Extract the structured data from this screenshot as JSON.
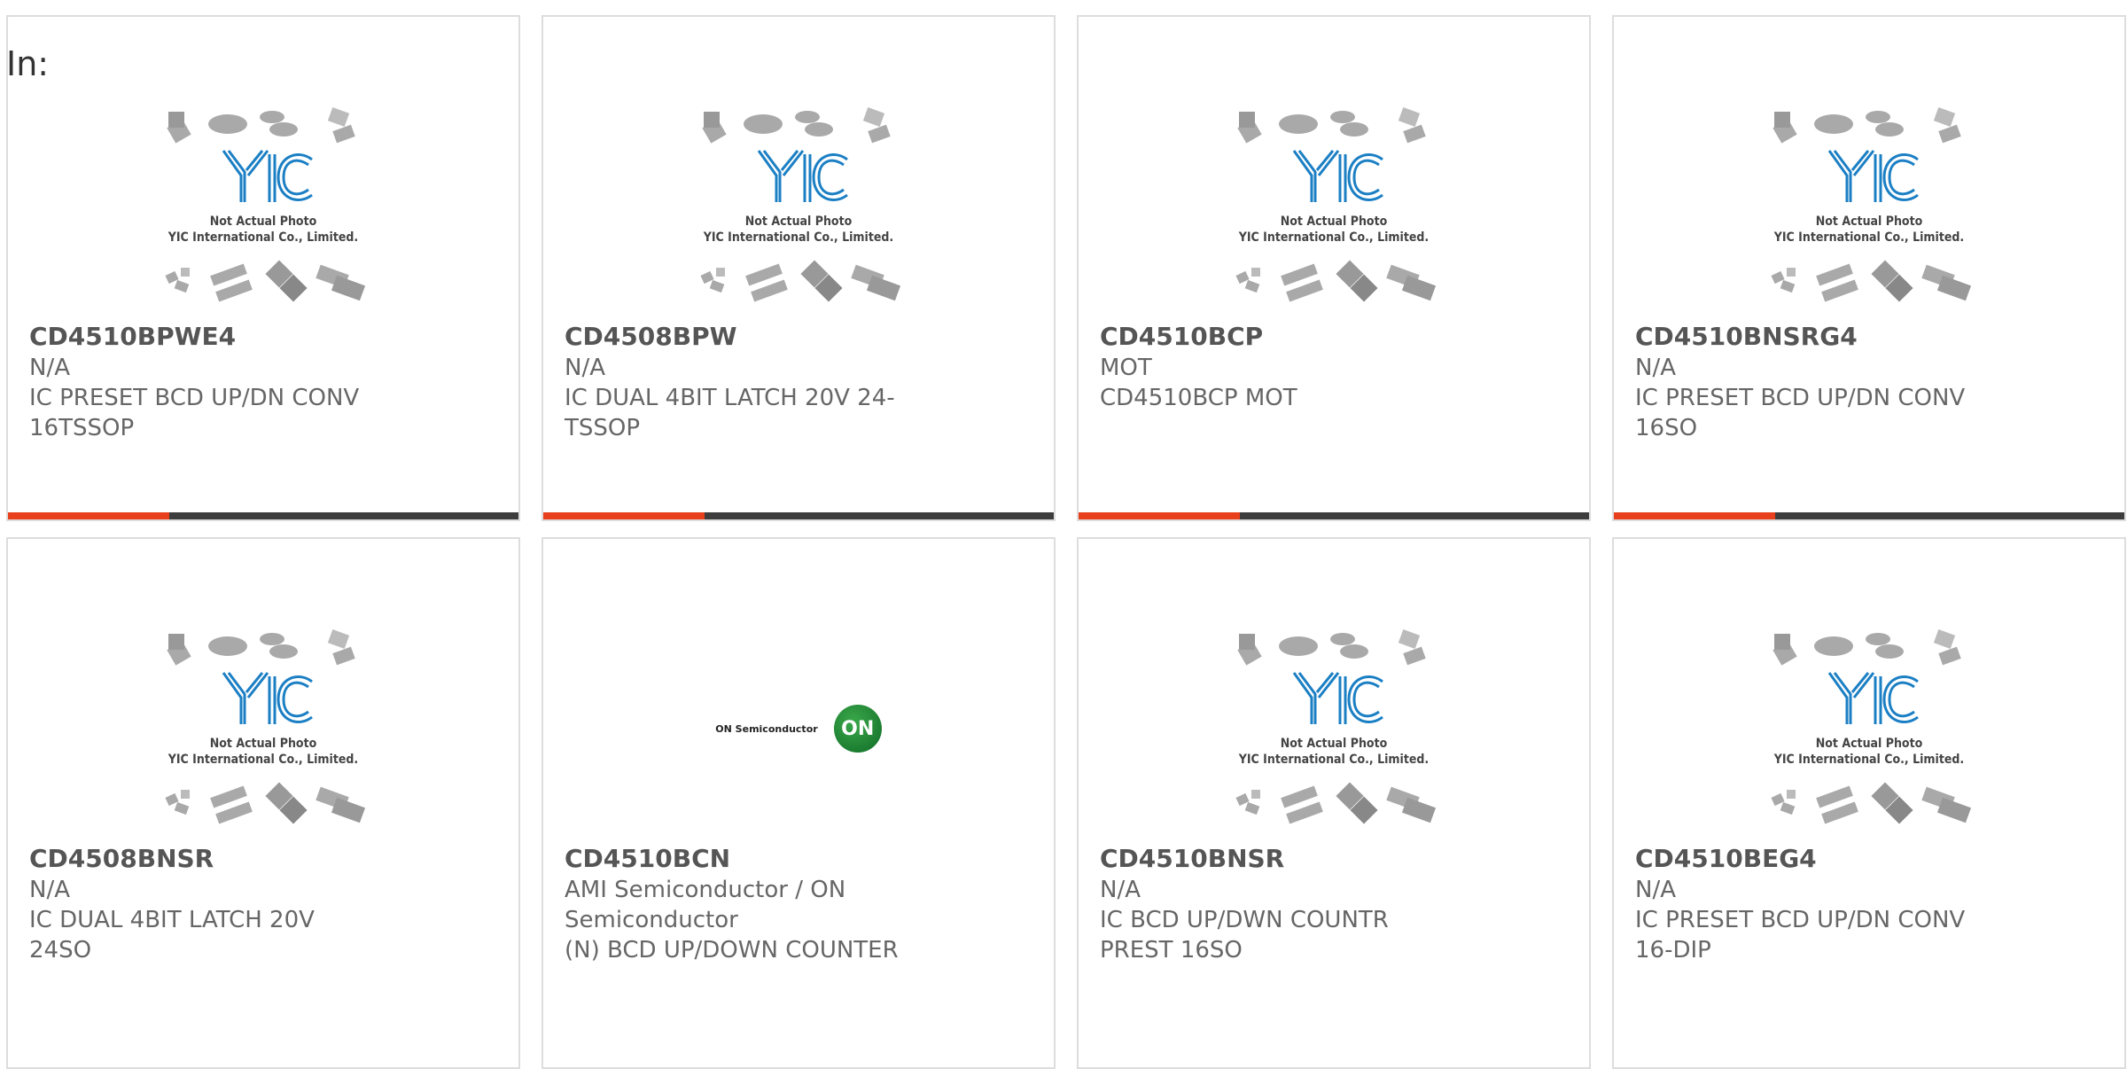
{
  "header": {
    "in_label": "In:"
  },
  "placeholder": {
    "line1": "Not Actual Photo",
    "line2": "YIC International Co., Limited."
  },
  "on_logo": {
    "text": "ON Semiconductor",
    "badge": "ON"
  },
  "colors": {
    "accent": "#e8401c",
    "bar": "#3d3d3d",
    "border": "#dddddd",
    "logo_blue": "#1b7fc4"
  },
  "products": [
    {
      "part": "CD4510BPWE4",
      "mfr": "N/A",
      "desc": "IC PRESET BCD UP/DN CONV 16TSSOP",
      "image": "yic-placeholder-icon"
    },
    {
      "part": "CD4508BPW",
      "mfr": "N/A",
      "desc": "IC DUAL 4BIT LATCH 20V 24-TSSOP",
      "image": "yic-placeholder-icon"
    },
    {
      "part": "CD4510BCP",
      "mfr": "MOT",
      "desc": "CD4510BCP MOT",
      "image": "yic-placeholder-icon"
    },
    {
      "part": "CD4510BNSRG4",
      "mfr": "N/A",
      "desc": "IC PRESET BCD UP/DN CONV 16SO",
      "image": "yic-placeholder-icon"
    },
    {
      "part": "CD4508BNSR",
      "mfr": "N/A",
      "desc": "IC DUAL 4BIT LATCH 20V 24SO",
      "image": "yic-placeholder-icon"
    },
    {
      "part": "CD4510BCN",
      "mfr": "AMI Semiconductor / ON Semiconductor",
      "desc": "(N) BCD UP/DOWN COUNTER",
      "image": "on-semiconductor-logo"
    },
    {
      "part": "CD4510BNSR",
      "mfr": "N/A",
      "desc": "IC BCD UP/DWN COUNTR PREST 16SO",
      "image": "yic-placeholder-icon"
    },
    {
      "part": "CD4510BEG4",
      "mfr": "N/A",
      "desc": "IC PRESET BCD UP/DN CONV 16-DIP",
      "image": "yic-placeholder-icon"
    }
  ]
}
